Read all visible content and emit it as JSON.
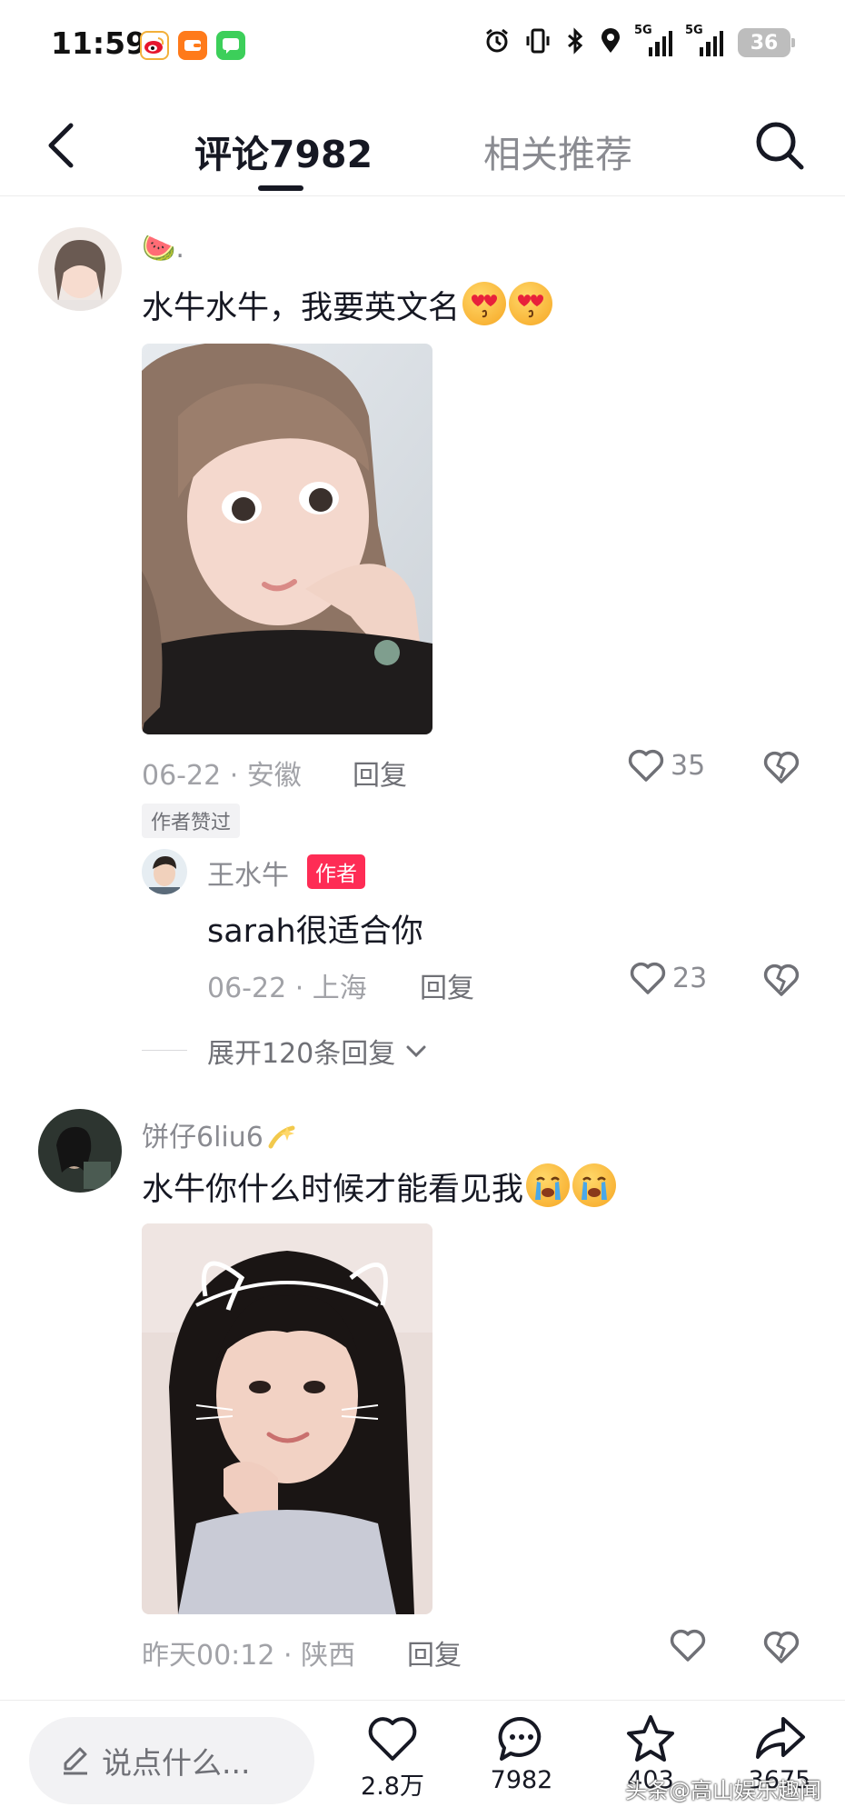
{
  "status_bar": {
    "time": "11:59",
    "network_1": "5G",
    "network_2": "5G",
    "battery": "36"
  },
  "header": {
    "tab_comments": "评论7982",
    "tab_related": "相关推荐"
  },
  "comments": [
    {
      "username": "🍉.",
      "text": "水牛水牛，我要英文名",
      "date": "06-22 · 安徽",
      "reply_label": "回复",
      "likes": "35",
      "author_liked": "作者赞过",
      "replies": [
        {
          "username": "王水牛",
          "badge": "作者",
          "text": "sarah很适合你",
          "date": "06-22 · 上海",
          "reply_label": "回复",
          "likes": "23"
        }
      ],
      "expand_label": "展开120条回复"
    },
    {
      "username": "饼仔6liu6",
      "text": "水牛你什么时候才能看见我",
      "date": "昨天00:12 · 陕西",
      "reply_label": "回复"
    }
  ],
  "bottom_bar": {
    "input_placeholder": "说点什么...",
    "like_count": "2.8万",
    "comment_count": "7982",
    "favorite_count": "403",
    "share_count": "3675"
  },
  "watermark": "头条@高山娱乐趣闻",
  "colors": {
    "accent": "#fe2c55",
    "text_primary": "#161823",
    "text_secondary": "#8a8b91"
  }
}
